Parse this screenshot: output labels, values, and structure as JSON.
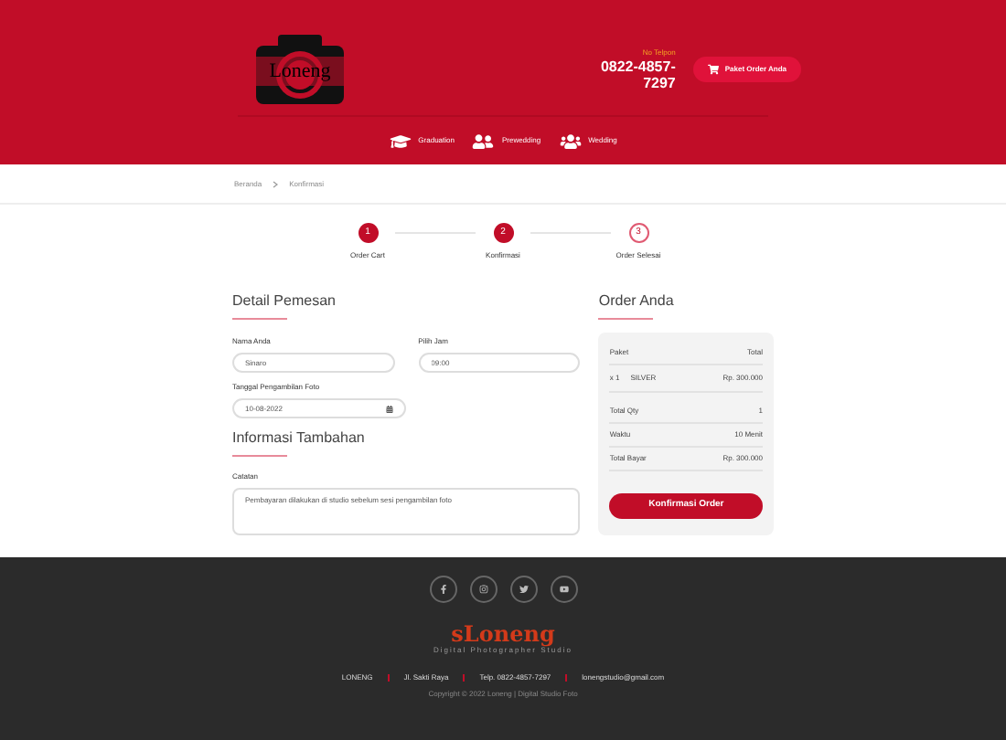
{
  "header": {
    "logo_text": "Loneng",
    "phone_label": "No Telpon",
    "phone": "0822-4857-7297",
    "cart_button": "Paket Order Anda"
  },
  "nav": [
    {
      "kind": "graduation",
      "label": "Graduation"
    },
    {
      "kind": "couple",
      "label": "Prewedding"
    },
    {
      "kind": "group",
      "label": "Wedding"
    }
  ],
  "breadcrumb": [
    "Beranda",
    "Konfirmasi"
  ],
  "steps": [
    {
      "number": "1",
      "label": "Order Cart",
      "done": true
    },
    {
      "number": "2",
      "label": "Konfirmasi",
      "done": true
    },
    {
      "number": "3",
      "label": "Order Selesai",
      "done": false
    }
  ],
  "form": {
    "title": "Detail Pemesan",
    "fields": [
      {
        "label": "Nama Anda",
        "value": "Sinaro"
      },
      {
        "label": "Pilih Jam",
        "value": "09:00"
      }
    ],
    "date": {
      "label": "Tanggal Pengambilan Foto",
      "value": "10-08-2022"
    },
    "extra_title": "Informasi Tambahan",
    "note": {
      "label": "Catatan",
      "value": "Pembayaran dilakukan di studio sebelum sesi pengambilan foto"
    }
  },
  "order": {
    "title": "Order Anda",
    "head": [
      "Paket",
      "Total"
    ],
    "qty": "x 1",
    "package": "SILVER",
    "price": "Rp. 300.000",
    "summary": [
      {
        "label": "Total Qty",
        "value": "1"
      },
      {
        "label": "Waktu",
        "value": "10 Menit"
      },
      {
        "label": "Total Bayar",
        "value": "Rp. 300.000"
      }
    ],
    "button": "Konfirmasi Order"
  },
  "footer": {
    "social": [
      {
        "kind": "facebook"
      },
      {
        "kind": "instagram"
      },
      {
        "kind": "twitter"
      },
      {
        "kind": "youtube"
      }
    ],
    "logo_text": "sLoneng",
    "logo_subtitle": "Digital Photographer Studio",
    "info": [
      "LONENG",
      "Jl. Sakti Raya",
      "Telp. 0822-4857-7297",
      "lonengstudio@gmail.com"
    ],
    "copyright": "Copyright © 2022 Loneng | Digital Studio Foto"
  }
}
